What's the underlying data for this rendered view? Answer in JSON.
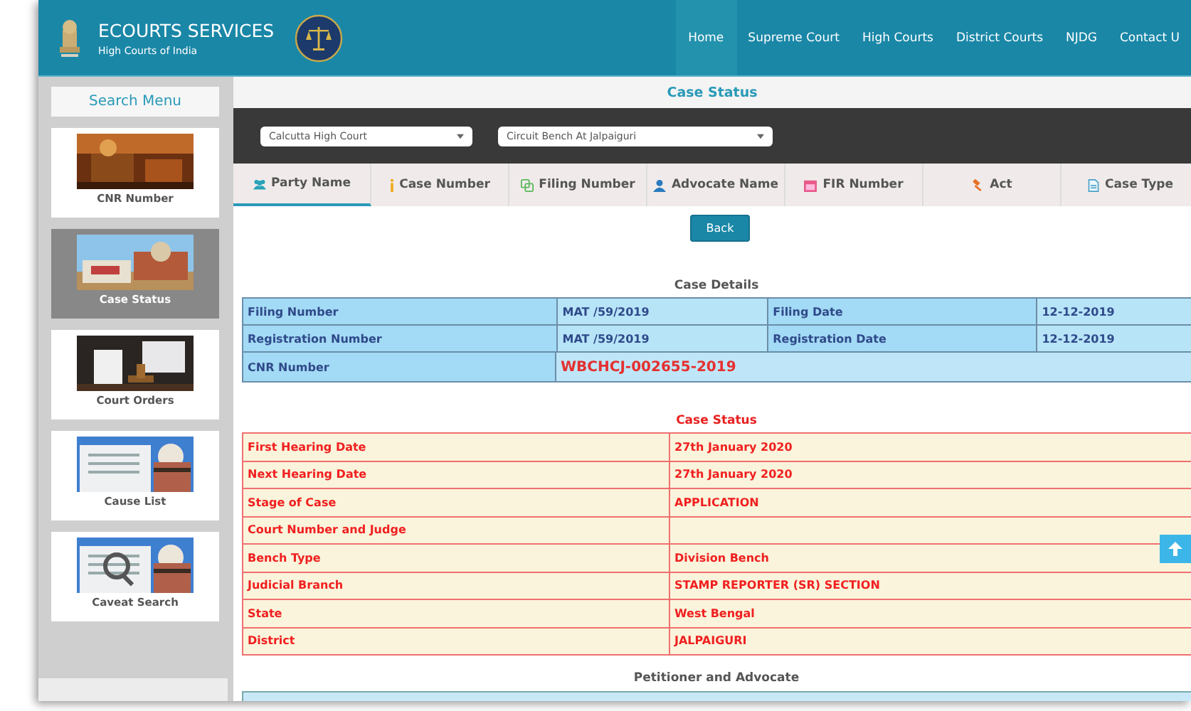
{
  "header": {
    "title": "ECOURTS SERVICES",
    "subtitle": "High Courts of India",
    "nav": [
      {
        "label": "Home",
        "selected": true
      },
      {
        "label": "Supreme Court",
        "selected": false
      },
      {
        "label": "High Courts",
        "selected": false
      },
      {
        "label": "District Courts",
        "selected": false
      },
      {
        "label": "NJDG",
        "selected": false
      },
      {
        "label": "Contact U",
        "selected": false
      }
    ]
  },
  "sidebar": {
    "title": "Search Menu",
    "items": [
      {
        "label": "CNR Number",
        "selected": false
      },
      {
        "label": "Case Status",
        "selected": true
      },
      {
        "label": "Court Orders",
        "selected": false
      },
      {
        "label": "Cause List",
        "selected": false
      },
      {
        "label": "Caveat Search",
        "selected": false
      }
    ]
  },
  "panel": {
    "title": "Case Status",
    "selects": [
      {
        "value": "Calcutta High Court"
      },
      {
        "value": "Circuit Bench At Jalpaiguri"
      }
    ],
    "tabs": [
      {
        "label": "Party Name",
        "selected": true
      },
      {
        "label": "Case Number",
        "selected": false
      },
      {
        "label": "Filing Number",
        "selected": false
      },
      {
        "label": "Advocate Name",
        "selected": false
      },
      {
        "label": "FIR Number",
        "selected": false
      },
      {
        "label": "Act",
        "selected": false
      },
      {
        "label": "Case Type",
        "selected": false
      }
    ],
    "back_button": "Back",
    "case_details": {
      "heading": "Case Details",
      "rows": [
        {
          "cells": [
            "Filing Number",
            "MAT /59/2019",
            "Filing Date",
            "12-12-2019"
          ]
        },
        {
          "cells": [
            "Registration Number",
            "MAT /59/2019",
            "Registration Date",
            "12-12-2019"
          ]
        }
      ],
      "cnr_row": {
        "label": "CNR Number",
        "value": "WBCHCJ-002655-2019"
      }
    },
    "case_status": {
      "heading": "Case Status",
      "rows": [
        {
          "label": "First Hearing Date",
          "value": "27th January 2020"
        },
        {
          "label": "Next Hearing Date",
          "value": "27th January 2020"
        },
        {
          "label": "Stage of Case",
          "value": "APPLICATION"
        },
        {
          "label": "Court Number and Judge"
        },
        {
          "label": "Bench Type",
          "value": "Division Bench"
        },
        {
          "label": "Judicial Branch",
          "value": "STAMP REPORTER (SR) SECTION"
        },
        {
          "label": "State",
          "value": "West Bengal"
        },
        {
          "label": "District",
          "value": "JALPAIGURI"
        }
      ]
    },
    "petitioner": {
      "heading": "Petitioner and Advocate"
    }
  }
}
